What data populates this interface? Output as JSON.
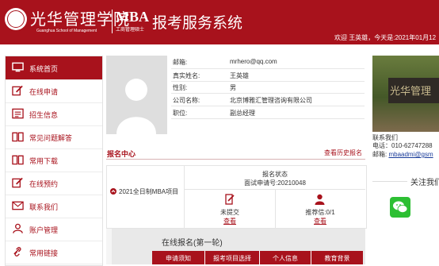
{
  "header": {
    "school_name_cn": "光华管理学院",
    "school_name_en": "Guanghua School of Management",
    "program": "MBA",
    "program_sub": "工商管理硕士",
    "system_title": "报考服务系统",
    "welcome": "欢迎 王英雄，今天是:2021年01月12"
  },
  "sidebar": {
    "items": [
      {
        "label": "系统首页",
        "icon": "monitor-icon",
        "active": true
      },
      {
        "label": "在线申请",
        "icon": "edit-icon",
        "active": false
      },
      {
        "label": "招生信息",
        "icon": "info-icon",
        "active": false
      },
      {
        "label": "常见问题解答",
        "icon": "book-icon",
        "active": false
      },
      {
        "label": "常用下载",
        "icon": "book-icon",
        "active": false
      },
      {
        "label": "在线预约",
        "icon": "edit-icon",
        "active": false
      },
      {
        "label": "联系我们",
        "icon": "mail-icon",
        "active": false
      },
      {
        "label": "账户管理",
        "icon": "user-icon",
        "active": false
      },
      {
        "label": "常用链接",
        "icon": "link-icon",
        "active": false
      }
    ]
  },
  "profile": {
    "fields": [
      {
        "label": "邮箱:",
        "value": "mrhero@qq.com"
      },
      {
        "label": "真实姓名:",
        "value": "王英雄"
      },
      {
        "label": "性别:",
        "value": "男"
      },
      {
        "label": "公司名称:",
        "value": "北京博雅汇管理咨询有限公司"
      },
      {
        "label": "职位:",
        "value": "副总经理"
      }
    ]
  },
  "application_center": {
    "title": "报名中心",
    "history_link": "查看历史报名",
    "program_name": "2021全日制MBA项目",
    "status_title": "报名状态",
    "interview_number": "面试申请号:20210048",
    "materials_status": "未提交",
    "materials_link": "查看",
    "recommendation_status": "推荐信:0/1",
    "recommendation_link": "查看"
  },
  "online_registration": {
    "title": "在线报名(第一轮)",
    "tabs": [
      "申请须知",
      "报考项目选择",
      "个人信息",
      "教育背景"
    ]
  },
  "contact": {
    "title": "联系我们",
    "phone": "电话：010-62747288",
    "email_label": "邮箱:",
    "email": "mbaadmi@gsm"
  },
  "follow": {
    "title": "关注我们"
  },
  "photo_sign": "光华管理",
  "colors": {
    "brand": "#a8121c",
    "link": "#1a3c9a",
    "wechat": "#2dbf33"
  }
}
